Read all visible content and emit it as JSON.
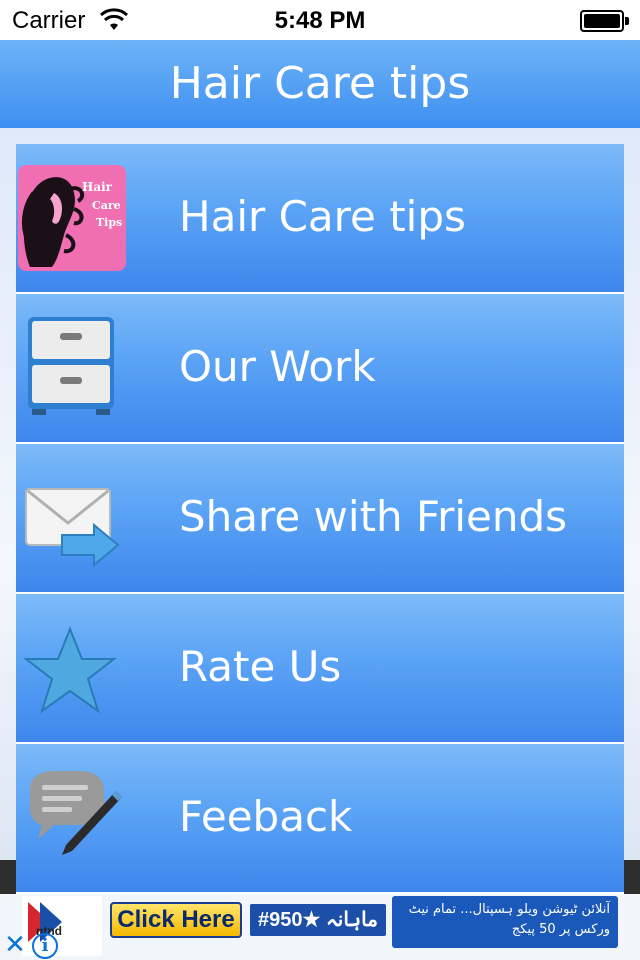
{
  "status_bar": {
    "carrier": "Carrier",
    "time": "5:48 PM",
    "wifi_icon": "wifi-icon",
    "battery_icon": "battery-icon"
  },
  "nav": {
    "title": "Hair Care tips"
  },
  "menu": [
    {
      "label": "Hair Care tips",
      "icon": "hair-care-logo-icon"
    },
    {
      "label": "Our Work",
      "icon": "drawer-cabinet-icon"
    },
    {
      "label": "Share with Friends",
      "icon": "envelope-forward-icon"
    },
    {
      "label": "Rate Us",
      "icon": "star-icon"
    },
    {
      "label": "Feeback",
      "icon": "speech-bubble-pencil-icon"
    }
  ],
  "logo_text": "Hair Care Tips",
  "ad": {
    "close_glyph": "✕",
    "info_glyph": "i",
    "brand": "ntnd",
    "click_label": "Click Here",
    "price_label": "#950★ ماہانہ",
    "urdu_text": "آنلائن ٹیوشن ویلو ہسپتال... تمام نیٹ ورکس پر 50 پیکج"
  },
  "colors": {
    "nav_top": "#6db3f7",
    "nav_bottom": "#3e8ff0",
    "menu_top": "#7dbaf8",
    "menu_bottom": "#3f86ec",
    "ad_blue": "#0a72d8"
  }
}
